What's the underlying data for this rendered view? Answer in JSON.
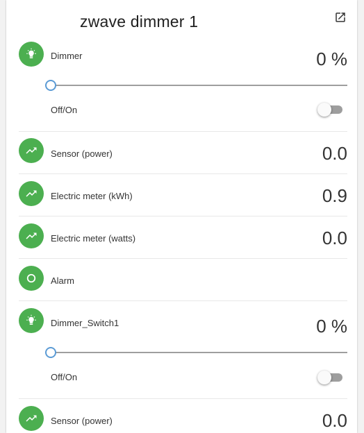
{
  "card": {
    "title": "zwave dimmer 1"
  },
  "colors": {
    "accent_green": "#4caf50",
    "slider_thumb": "#5b9bd5",
    "track": "#9e9e9e"
  },
  "entities": {
    "dimmer": {
      "icon": "lightbulb-icon",
      "label": "Dimmer",
      "value": "0 %",
      "brightness_percent": 0,
      "toggle_label": "Off/On",
      "toggle_on": false
    },
    "sensor_power": {
      "icon": "trending-up-icon",
      "label": "Sensor (power)",
      "value": "0.0"
    },
    "meter_kwh": {
      "icon": "trending-up-icon",
      "label": "Electric meter (kWh)",
      "value": "0.9"
    },
    "meter_watts": {
      "icon": "trending-up-icon",
      "label": "Electric meter (watts)",
      "value": "0.0"
    },
    "alarm": {
      "icon": "circle-outline-icon",
      "label": "Alarm"
    },
    "dimmer_switch1": {
      "icon": "lightbulb-icon",
      "label": "Dimmer_Switch1",
      "value": "0 %",
      "brightness_percent": 0,
      "toggle_label": "Off/On",
      "toggle_on": false
    },
    "sensor_power_2": {
      "icon": "trending-up-icon",
      "label": "Sensor (power)",
      "value": "0.0"
    }
  }
}
